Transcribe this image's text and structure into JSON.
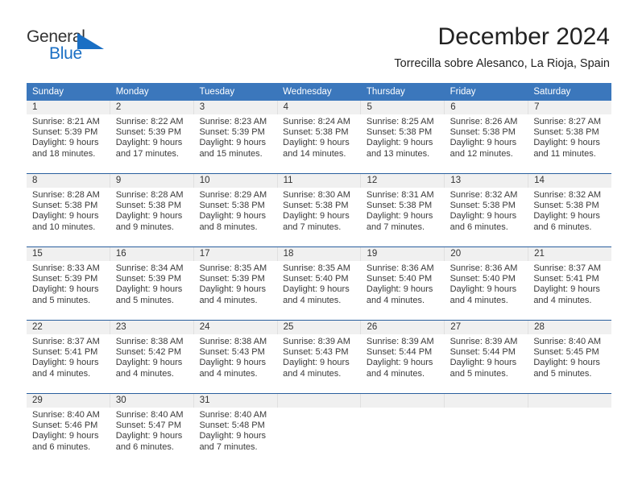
{
  "logo": {
    "text_top": "General",
    "text_bottom": "Blue",
    "triangle_icon": "blue-triangle-icon",
    "brand_blue": "#1a6fc4",
    "brand_dark": "#333333"
  },
  "header": {
    "title": "December 2024",
    "subtitle": "Torrecilla sobre Alesanco, La Rioja, Spain"
  },
  "calendar": {
    "header_bg": "#3b77bc",
    "daynum_bg": "#f0f0f0",
    "row_divider": "#2a5f9e",
    "day_names": [
      "Sunday",
      "Monday",
      "Tuesday",
      "Wednesday",
      "Thursday",
      "Friday",
      "Saturday"
    ],
    "weeks": [
      [
        {
          "day": "1",
          "lines": [
            "Sunrise: 8:21 AM",
            "Sunset: 5:39 PM",
            "Daylight: 9 hours",
            "and 18 minutes."
          ]
        },
        {
          "day": "2",
          "lines": [
            "Sunrise: 8:22 AM",
            "Sunset: 5:39 PM",
            "Daylight: 9 hours",
            "and 17 minutes."
          ]
        },
        {
          "day": "3",
          "lines": [
            "Sunrise: 8:23 AM",
            "Sunset: 5:39 PM",
            "Daylight: 9 hours",
            "and 15 minutes."
          ]
        },
        {
          "day": "4",
          "lines": [
            "Sunrise: 8:24 AM",
            "Sunset: 5:38 PM",
            "Daylight: 9 hours",
            "and 14 minutes."
          ]
        },
        {
          "day": "5",
          "lines": [
            "Sunrise: 8:25 AM",
            "Sunset: 5:38 PM",
            "Daylight: 9 hours",
            "and 13 minutes."
          ]
        },
        {
          "day": "6",
          "lines": [
            "Sunrise: 8:26 AM",
            "Sunset: 5:38 PM",
            "Daylight: 9 hours",
            "and 12 minutes."
          ]
        },
        {
          "day": "7",
          "lines": [
            "Sunrise: 8:27 AM",
            "Sunset: 5:38 PM",
            "Daylight: 9 hours",
            "and 11 minutes."
          ]
        }
      ],
      [
        {
          "day": "8",
          "lines": [
            "Sunrise: 8:28 AM",
            "Sunset: 5:38 PM",
            "Daylight: 9 hours",
            "and 10 minutes."
          ]
        },
        {
          "day": "9",
          "lines": [
            "Sunrise: 8:28 AM",
            "Sunset: 5:38 PM",
            "Daylight: 9 hours",
            "and 9 minutes."
          ]
        },
        {
          "day": "10",
          "lines": [
            "Sunrise: 8:29 AM",
            "Sunset: 5:38 PM",
            "Daylight: 9 hours",
            "and 8 minutes."
          ]
        },
        {
          "day": "11",
          "lines": [
            "Sunrise: 8:30 AM",
            "Sunset: 5:38 PM",
            "Daylight: 9 hours",
            "and 7 minutes."
          ]
        },
        {
          "day": "12",
          "lines": [
            "Sunrise: 8:31 AM",
            "Sunset: 5:38 PM",
            "Daylight: 9 hours",
            "and 7 minutes."
          ]
        },
        {
          "day": "13",
          "lines": [
            "Sunrise: 8:32 AM",
            "Sunset: 5:38 PM",
            "Daylight: 9 hours",
            "and 6 minutes."
          ]
        },
        {
          "day": "14",
          "lines": [
            "Sunrise: 8:32 AM",
            "Sunset: 5:38 PM",
            "Daylight: 9 hours",
            "and 6 minutes."
          ]
        }
      ],
      [
        {
          "day": "15",
          "lines": [
            "Sunrise: 8:33 AM",
            "Sunset: 5:39 PM",
            "Daylight: 9 hours",
            "and 5 minutes."
          ]
        },
        {
          "day": "16",
          "lines": [
            "Sunrise: 8:34 AM",
            "Sunset: 5:39 PM",
            "Daylight: 9 hours",
            "and 5 minutes."
          ]
        },
        {
          "day": "17",
          "lines": [
            "Sunrise: 8:35 AM",
            "Sunset: 5:39 PM",
            "Daylight: 9 hours",
            "and 4 minutes."
          ]
        },
        {
          "day": "18",
          "lines": [
            "Sunrise: 8:35 AM",
            "Sunset: 5:40 PM",
            "Daylight: 9 hours",
            "and 4 minutes."
          ]
        },
        {
          "day": "19",
          "lines": [
            "Sunrise: 8:36 AM",
            "Sunset: 5:40 PM",
            "Daylight: 9 hours",
            "and 4 minutes."
          ]
        },
        {
          "day": "20",
          "lines": [
            "Sunrise: 8:36 AM",
            "Sunset: 5:40 PM",
            "Daylight: 9 hours",
            "and 4 minutes."
          ]
        },
        {
          "day": "21",
          "lines": [
            "Sunrise: 8:37 AM",
            "Sunset: 5:41 PM",
            "Daylight: 9 hours",
            "and 4 minutes."
          ]
        }
      ],
      [
        {
          "day": "22",
          "lines": [
            "Sunrise: 8:37 AM",
            "Sunset: 5:41 PM",
            "Daylight: 9 hours",
            "and 4 minutes."
          ]
        },
        {
          "day": "23",
          "lines": [
            "Sunrise: 8:38 AM",
            "Sunset: 5:42 PM",
            "Daylight: 9 hours",
            "and 4 minutes."
          ]
        },
        {
          "day": "24",
          "lines": [
            "Sunrise: 8:38 AM",
            "Sunset: 5:43 PM",
            "Daylight: 9 hours",
            "and 4 minutes."
          ]
        },
        {
          "day": "25",
          "lines": [
            "Sunrise: 8:39 AM",
            "Sunset: 5:43 PM",
            "Daylight: 9 hours",
            "and 4 minutes."
          ]
        },
        {
          "day": "26",
          "lines": [
            "Sunrise: 8:39 AM",
            "Sunset: 5:44 PM",
            "Daylight: 9 hours",
            "and 4 minutes."
          ]
        },
        {
          "day": "27",
          "lines": [
            "Sunrise: 8:39 AM",
            "Sunset: 5:44 PM",
            "Daylight: 9 hours",
            "and 5 minutes."
          ]
        },
        {
          "day": "28",
          "lines": [
            "Sunrise: 8:40 AM",
            "Sunset: 5:45 PM",
            "Daylight: 9 hours",
            "and 5 minutes."
          ]
        }
      ],
      [
        {
          "day": "29",
          "lines": [
            "Sunrise: 8:40 AM",
            "Sunset: 5:46 PM",
            "Daylight: 9 hours",
            "and 6 minutes."
          ]
        },
        {
          "day": "30",
          "lines": [
            "Sunrise: 8:40 AM",
            "Sunset: 5:47 PM",
            "Daylight: 9 hours",
            "and 6 minutes."
          ]
        },
        {
          "day": "31",
          "lines": [
            "Sunrise: 8:40 AM",
            "Sunset: 5:48 PM",
            "Daylight: 9 hours",
            "and 7 minutes."
          ]
        },
        {
          "day": "",
          "lines": []
        },
        {
          "day": "",
          "lines": []
        },
        {
          "day": "",
          "lines": []
        },
        {
          "day": "",
          "lines": []
        }
      ]
    ]
  }
}
